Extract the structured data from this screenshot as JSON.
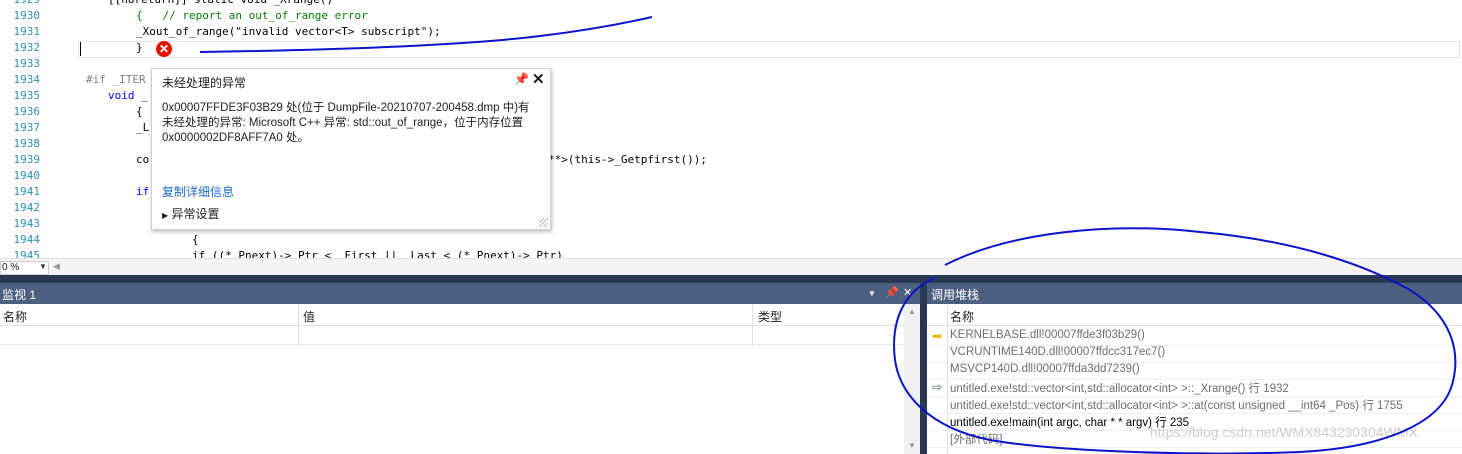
{
  "editor": {
    "line_numbers": [
      "1929",
      "1930",
      "1931",
      "1932",
      "1933",
      "1934",
      "1935",
      "1936",
      "1937",
      "1938",
      "1939",
      "1940",
      "1941",
      "1942",
      "1943",
      "1944",
      "1945"
    ],
    "lines": {
      "l1929": "[[noreturn]] static void _Xrange()",
      "l1930": "{   // report an out_of_range error",
      "l1931": "_Xout_of_range(\"invalid vector<T> subscript\");",
      "l1932": "}",
      "l1934": "#if _ITER",
      "l1935": "void _",
      "l1936": "{",
      "l1937": "_L",
      "l1939a": "co",
      "l1939b": "**>(this->_Getpfirst());",
      "l1941": "if",
      "l1944": "{",
      "l1945": "if ((*_Pnext)->_Ptr < _First || _Last < (*_Pnext)->_Ptr)"
    }
  },
  "exception_popup": {
    "title": "未经处理的异常",
    "pin_icon": "pin-icon",
    "close_icon": "close-icon",
    "message": "0x00007FFDE3F03B29 处(位于 DumpFile-20210707-200458.dmp 中)有未经处理的异常: Microsoft C++ 异常: std::out_of_range，位于内存位置 0x0000002DF8AFF7A0 处。",
    "copy_link": "复制详细信息",
    "settings_label": "异常设置"
  },
  "status": {
    "zoom": "0 %"
  },
  "watch": {
    "title": "监视 1",
    "columns": [
      "名称",
      "值",
      "类型"
    ]
  },
  "callstack": {
    "title": "调用堆栈",
    "column": "名称",
    "frames": [
      {
        "text": "KERNELBASE.dll!00007ffde3f03b29()",
        "icon": "current-frame-arrow-icon",
        "style": "gray"
      },
      {
        "text": "VCRUNTIME140D.dll!00007ffdcc317ec7()",
        "icon": "",
        "style": "gray"
      },
      {
        "text": "MSVCP140D.dll!00007ffda3dd7239()",
        "icon": "",
        "style": "gray"
      },
      {
        "text": "untitled.exe!std::vector<int,std::allocator<int> >::_Xrange() 行 1932",
        "icon": "selected-frame-arrow-icon",
        "style": "gray"
      },
      {
        "text": "untitled.exe!std::vector<int,std::allocator<int> >::at(const unsigned __int64 _Pos) 行 1755",
        "icon": "",
        "style": "gray"
      },
      {
        "text": "untitled.exe!main(int argc, char * * argv) 行 235",
        "icon": "",
        "style": "black"
      },
      {
        "text": "[外部代码]",
        "icon": "",
        "style": "gray"
      }
    ]
  },
  "watermark": "https://blog.csdn.net/WMX843230304WMX",
  "colors": {
    "tool_title": "#4d6082",
    "splitter": "#293955",
    "error": "#e51400",
    "link": "#1b6ac9",
    "ink": "#0a14c8"
  }
}
